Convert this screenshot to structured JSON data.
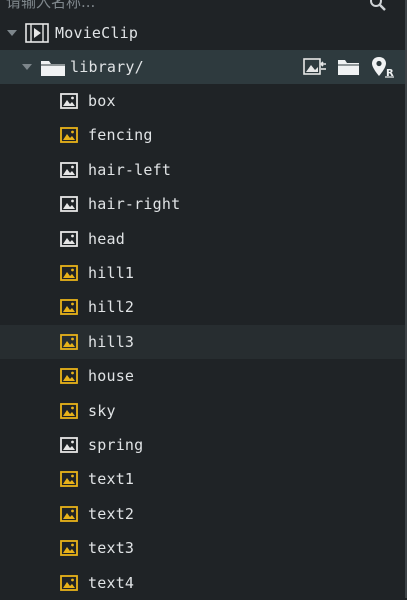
{
  "search": {
    "placeholder": "请输入名称..."
  },
  "tree": {
    "root": {
      "label": "MovieClip"
    },
    "folder": {
      "label": "library/"
    }
  },
  "assets": [
    {
      "label": "box",
      "type": "white"
    },
    {
      "label": "fencing",
      "type": "yellow"
    },
    {
      "label": "hair-left",
      "type": "white"
    },
    {
      "label": "hair-right",
      "type": "white"
    },
    {
      "label": "head",
      "type": "white"
    },
    {
      "label": "hill1",
      "type": "yellow"
    },
    {
      "label": "hill2",
      "type": "yellow"
    },
    {
      "label": "hill3",
      "type": "yellow"
    },
    {
      "label": "house",
      "type": "yellow"
    },
    {
      "label": "sky",
      "type": "yellow"
    },
    {
      "label": "spring",
      "type": "white"
    },
    {
      "label": "text1",
      "type": "yellow"
    },
    {
      "label": "text2",
      "type": "yellow"
    },
    {
      "label": "text3",
      "type": "yellow"
    },
    {
      "label": "text4",
      "type": "yellow"
    }
  ],
  "highlighted_asset": "hill3",
  "colors": {
    "yellow_icon": "#e8b21a",
    "white_icon": "#e6e6e6",
    "selected_row": "#2e3a3e",
    "panel_bg": "#1f2326"
  }
}
